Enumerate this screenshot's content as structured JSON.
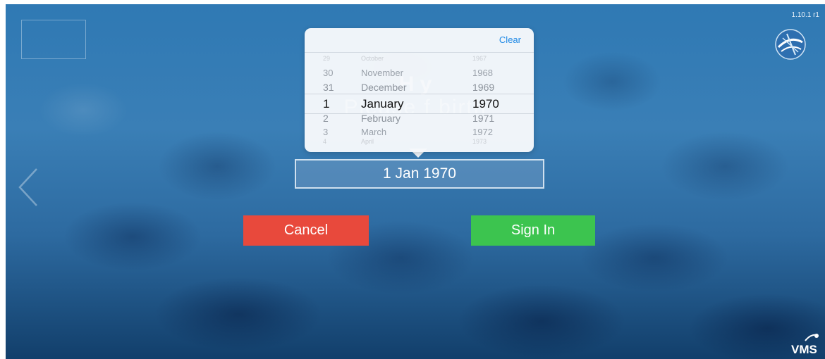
{
  "app": {
    "version": "1.10.1 r1",
    "brand_logo": "VMS",
    "accent_colors": {
      "cancel": "#e8493c",
      "sign_in": "#3cc44f",
      "link": "#1e88e5"
    }
  },
  "greeting": {
    "title": "H                 y",
    "subtitle": "Please                 f birth"
  },
  "date_picker": {
    "clear_label": "Clear",
    "days": [
      "29",
      "30",
      "31",
      "1",
      "2",
      "3",
      "4"
    ],
    "months": [
      "October",
      "November",
      "December",
      "January",
      "February",
      "March",
      "April"
    ],
    "years": [
      "1967",
      "1968",
      "1969",
      "1970",
      "1971",
      "1972",
      "1973"
    ],
    "selected_index": 3
  },
  "date_field": {
    "value": "1 Jan 1970"
  },
  "buttons": {
    "cancel": "Cancel",
    "sign_in": "Sign In"
  },
  "icons": {
    "back": "chevron-left-icon",
    "globe": "globe-logo-icon"
  }
}
